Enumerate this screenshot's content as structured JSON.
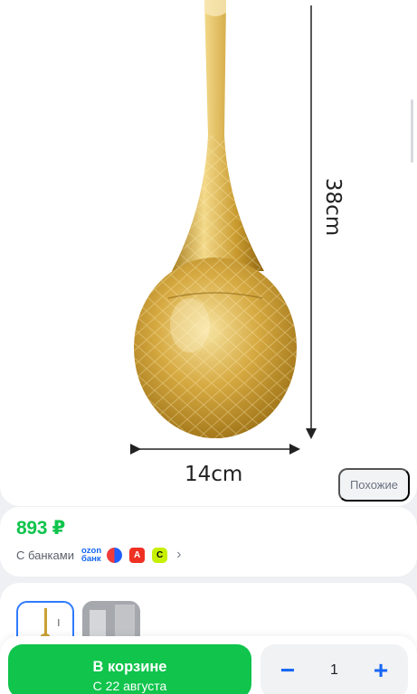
{
  "product_image": {
    "height_label": "38cm",
    "width_label": "14cm",
    "similar_label": "Похожие"
  },
  "price_block": {
    "price": "893 ₽",
    "banks_label": "С банками",
    "ozon_bank_logo": [
      "ozon",
      "банк"
    ],
    "bank_icons": [
      "tinkoff-icon",
      "alfa-icon",
      "green-bank-icon"
    ]
  },
  "thumbnails": [
    "gold-brush-thumbnail",
    "gray-bath-thumbnail"
  ],
  "action_bar": {
    "cart_title": "В корзине",
    "cart_subtitle": "С 22 августа",
    "quantity": "1",
    "minus_label": "−",
    "plus_label": "+"
  },
  "colors": {
    "accent_green": "#10c44c",
    "accent_blue": "#1766f5",
    "gold": "#c9a233"
  }
}
